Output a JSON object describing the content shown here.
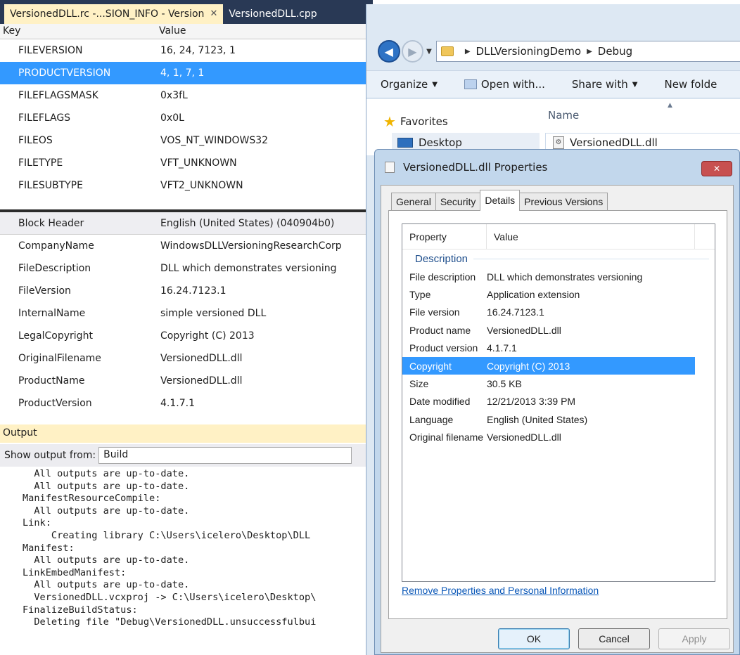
{
  "vs": {
    "tabs": [
      {
        "label": "VersionedDLL.rc -...SION_INFO - Version",
        "close": "✕"
      },
      {
        "label": "VersionedDLL.cpp"
      }
    ],
    "grid_header": {
      "key": "Key",
      "value": "Value"
    },
    "fixed_rows": [
      {
        "key": "FILEVERSION",
        "value": "16, 24, 7123, 1"
      },
      {
        "key": "PRODUCTVERSION",
        "value": "4, 1, 7, 1"
      },
      {
        "key": "FILEFLAGSMASK",
        "value": "0x3fL"
      },
      {
        "key": "FILEFLAGS",
        "value": "0x0L"
      },
      {
        "key": "FILEOS",
        "value": "VOS_NT_WINDOWS32"
      },
      {
        "key": "FILETYPE",
        "value": "VFT_UNKNOWN"
      },
      {
        "key": "FILESUBTYPE",
        "value": "VFT2_UNKNOWN"
      }
    ],
    "block_rows": [
      {
        "key": "Block Header",
        "value": "English (United States) (040904b0)"
      },
      {
        "key": "CompanyName",
        "value": "WindowsDLLVersioningResearchCorp"
      },
      {
        "key": "FileDescription",
        "value": "DLL which demonstrates versioning"
      },
      {
        "key": "FileVersion",
        "value": "16.24.7123.1"
      },
      {
        "key": "InternalName",
        "value": "simple versioned DLL"
      },
      {
        "key": "LegalCopyright",
        "value": "Copyright (C) 2013"
      },
      {
        "key": "OriginalFilename",
        "value": "VersionedDLL.dll"
      },
      {
        "key": "ProductName",
        "value": "VersionedDLL.dll"
      },
      {
        "key": "ProductVersion",
        "value": "4.1.7.1"
      }
    ],
    "output": {
      "title": "Output",
      "show_from_label": "Show output from:",
      "show_from_value": "Build",
      "lines": [
        "  All outputs are up-to-date.",
        "  All outputs are up-to-date.",
        "ManifestResourceCompile:",
        "  All outputs are up-to-date.",
        "Link:",
        "     Creating library C:\\Users\\icelero\\Desktop\\DLL",
        "Manifest:",
        "  All outputs are up-to-date.",
        "LinkEmbedManifest:",
        "  All outputs are up-to-date.",
        "  VersionedDLL.vcxproj -> C:\\Users\\icelero\\Desktop\\",
        "FinalizeBuildStatus:",
        "  Deleting file \"Debug\\VersionedDLL.unsuccessfulbui"
      ]
    }
  },
  "explorer": {
    "breadcrumb": [
      "DLLVersioningDemo",
      "Debug"
    ],
    "commands": {
      "organize": "Organize",
      "open_with": "Open with...",
      "share_with": "Share with",
      "new_folder": "New folde"
    },
    "nav": {
      "favorites": "Favorites",
      "desktop": "Desktop"
    },
    "name_column": "Name",
    "file_name": "VersionedDLL.dll"
  },
  "dialog": {
    "title": "VersionedDLL.dll Properties",
    "close": "✕",
    "tabs": [
      "General",
      "Security",
      "Details",
      "Previous Versions"
    ],
    "columns": {
      "property": "Property",
      "value": "Value"
    },
    "group": "Description",
    "rows": [
      {
        "property": "File description",
        "value": "DLL which demonstrates versioning"
      },
      {
        "property": "Type",
        "value": "Application extension"
      },
      {
        "property": "File version",
        "value": "16.24.7123.1"
      },
      {
        "property": "Product name",
        "value": "VersionedDLL.dll"
      },
      {
        "property": "Product version",
        "value": "4.1.7.1"
      },
      {
        "property": "Copyright",
        "value": "Copyright (C) 2013"
      },
      {
        "property": "Size",
        "value": "30.5 KB"
      },
      {
        "property": "Date modified",
        "value": "12/21/2013 3:39 PM"
      },
      {
        "property": "Language",
        "value": "English (United States)"
      },
      {
        "property": "Original filename",
        "value": "VersionedDLL.dll"
      }
    ],
    "remove_link": "Remove Properties and Personal Information",
    "buttons": {
      "ok": "OK",
      "cancel": "Cancel",
      "apply": "Apply"
    }
  }
}
